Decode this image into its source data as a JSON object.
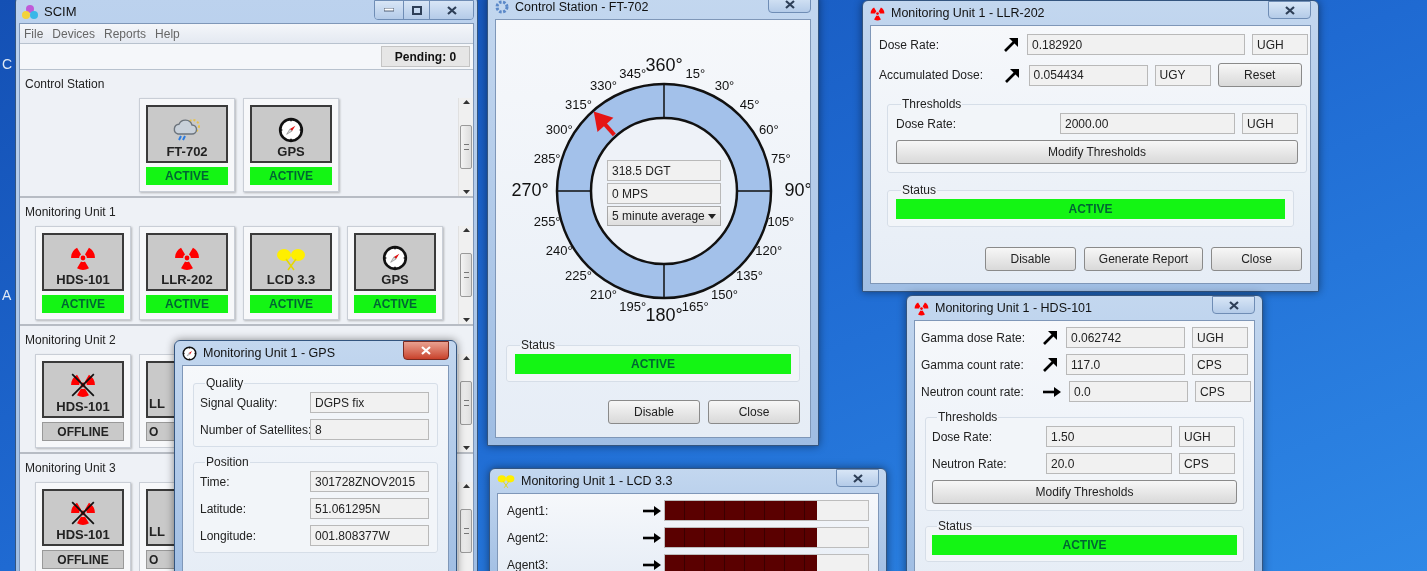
{
  "desktop": {
    "labels": [
      "C",
      "A"
    ]
  },
  "main_window": {
    "title": "SCIM",
    "menu": [
      "File",
      "Devices",
      "Reports",
      "Help"
    ],
    "pending": "Pending: 0",
    "sections": [
      {
        "title": "Control Station",
        "devices": [
          {
            "name": "FT-702",
            "kind": "weather",
            "status": "ACTIVE",
            "active": true
          },
          {
            "name": "GPS",
            "kind": "compass",
            "status": "ACTIVE",
            "active": true
          }
        ]
      },
      {
        "title": "Monitoring Unit 1",
        "devices": [
          {
            "name": "HDS-101",
            "kind": "radiation",
            "status": "ACTIVE",
            "active": true
          },
          {
            "name": "LLR-202",
            "kind": "radiation",
            "status": "ACTIVE",
            "active": true
          },
          {
            "name": "LCD 3.3",
            "kind": "agent",
            "status": "ACTIVE",
            "active": true
          },
          {
            "name": "GPS",
            "kind": "compass",
            "status": "ACTIVE",
            "active": true
          }
        ]
      },
      {
        "title": "Monitoring Unit 2",
        "devices": [
          {
            "name": "HDS-101",
            "kind": "radiation",
            "status": "OFFLINE",
            "active": false
          },
          {
            "name": "LL",
            "status": "O",
            "active": false,
            "cut": true
          }
        ]
      },
      {
        "title": "Monitoring Unit 3",
        "devices": [
          {
            "name": "HDS-101",
            "kind": "radiation",
            "status": "OFFLINE",
            "active": false
          },
          {
            "name": "LL",
            "status": "O",
            "active": false,
            "cut": true
          }
        ]
      }
    ]
  },
  "ft702_window": {
    "title": "Control Station - FT-702",
    "active": false,
    "right_scale": [
      "360°",
      "15°",
      "30°",
      "45°",
      "60°",
      "75°",
      "90°",
      "105°",
      "120°",
      "135°",
      "150°",
      "165°",
      "180°"
    ],
    "left_scale": [
      "345°",
      "330°",
      "315°",
      "300°",
      "285°",
      "270°",
      "255°",
      "240°",
      "225°",
      "210°",
      "195°"
    ],
    "direction": "318.5 DGT",
    "speed": "0 MPS",
    "average": "5 minute average",
    "status_title": "Status",
    "status": "ACTIVE",
    "status_active": true,
    "buttons": [
      "Disable",
      "Close"
    ]
  },
  "llr_window": {
    "title": "Monitoring Unit 1 - LLR-202",
    "active": false,
    "readings": [
      {
        "label": "Dose Rate:",
        "kind": "up",
        "value": "0.182920",
        "unit": "UGH"
      },
      {
        "label": "Accumulated Dose:",
        "kind": "up",
        "value": "0.054434",
        "unit": "UGY",
        "action": "Reset"
      }
    ],
    "thresholds": {
      "title": "Thresholds",
      "rows": [
        {
          "label": "Dose Rate:",
          "value": "2000.00",
          "unit": "UGH"
        }
      ],
      "button": "Modify Thresholds"
    },
    "status_title": "Status",
    "status": "ACTIVE",
    "status_active": true,
    "buttons": [
      "Disable",
      "Generate Report",
      "Close"
    ]
  },
  "hds_window": {
    "title": "Monitoring Unit 1 - HDS-101",
    "active": false,
    "readings": [
      {
        "label": "Gamma dose Rate:",
        "kind": "up",
        "value": "0.062742",
        "unit": "UGH"
      },
      {
        "label": "Gamma count rate:",
        "kind": "up",
        "value": "117.0",
        "unit": "CPS"
      },
      {
        "label": "Neutron count rate:",
        "kind": "flat",
        "value": "0.0",
        "unit": "CPS"
      }
    ],
    "thresholds": {
      "title": "Thresholds",
      "rows": [
        {
          "label": "Dose Rate:",
          "value": "1.50",
          "unit": "UGH"
        },
        {
          "label": "Neutron Rate:",
          "value": "20.0",
          "unit": "CPS"
        }
      ],
      "button": "Modify Thresholds"
    },
    "status_title": "Status",
    "status": "ACTIVE",
    "status_active": true
  },
  "gps_window": {
    "title": "Monitoring Unit 1 - GPS",
    "active": true,
    "groups": [
      {
        "title": "Quality",
        "rows": [
          {
            "label": "Signal Quality:",
            "value": "DGPS fix"
          },
          {
            "label": "Number of Satellites:",
            "value": "8"
          }
        ]
      },
      {
        "title": "Position",
        "rows": [
          {
            "label": "Time:",
            "value": "301728ZNOV2015"
          },
          {
            "label": "Latitude:",
            "value": "51.061295N"
          },
          {
            "label": "Longitude:",
            "value": "001.808377W"
          }
        ]
      }
    ]
  },
  "lcd_window": {
    "title": "Monitoring Unit 1 - LCD 3.3",
    "active": false,
    "agents": [
      {
        "label": "Agent1:",
        "kind": "flat",
        "level": 0.75
      },
      {
        "label": "Agent2:",
        "kind": "flat",
        "level": 0.75
      },
      {
        "label": "Agent3:",
        "kind": "flat",
        "level": 0.75
      }
    ]
  }
}
